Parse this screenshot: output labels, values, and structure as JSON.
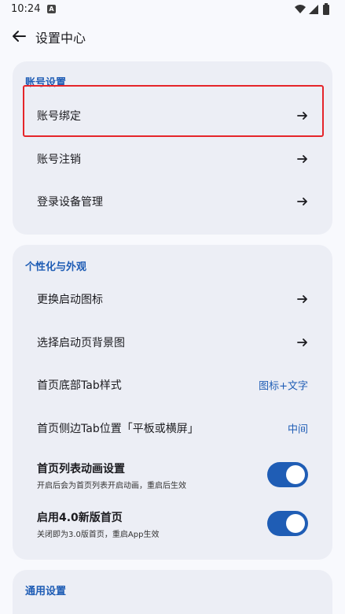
{
  "status_bar": {
    "time": "10:24",
    "notification_badge": "A",
    "icons": [
      "wifi-icon",
      "signal-icon",
      "battery-icon"
    ]
  },
  "app_bar": {
    "title": "设置中心",
    "back_icon": "arrow-left-icon"
  },
  "sections": {
    "account": {
      "title": "账号设置",
      "items": [
        {
          "label": "账号绑定",
          "icon": "arrow-right-icon"
        },
        {
          "label": "账号注销",
          "icon": "arrow-right-icon"
        },
        {
          "label": "登录设备管理",
          "icon": "arrow-right-icon"
        }
      ]
    },
    "personalization": {
      "title": "个性化与外观",
      "items": [
        {
          "label": "更换启动图标",
          "icon": "arrow-right-icon"
        },
        {
          "label": "选择启动页背景图",
          "icon": "arrow-right-icon"
        },
        {
          "label": "首页底部Tab样式",
          "value": "图标+文字"
        },
        {
          "label": "首页侧边Tab位置「平板或横屏」",
          "value": "中间"
        },
        {
          "label": "首页列表动画设置",
          "desc": "开启后会为首页列表开启动画，重启后生效",
          "toggle": true
        },
        {
          "label": "启用4.0新版首页",
          "desc": "关闭即为3.0版首页，重启App生效",
          "toggle": true
        }
      ]
    },
    "general": {
      "title": "通用设置"
    }
  },
  "colors": {
    "accent": "#1f5db5",
    "card_bg": "#eceef5",
    "page_bg": "#f8f9fd",
    "highlight": "#e5252a"
  }
}
